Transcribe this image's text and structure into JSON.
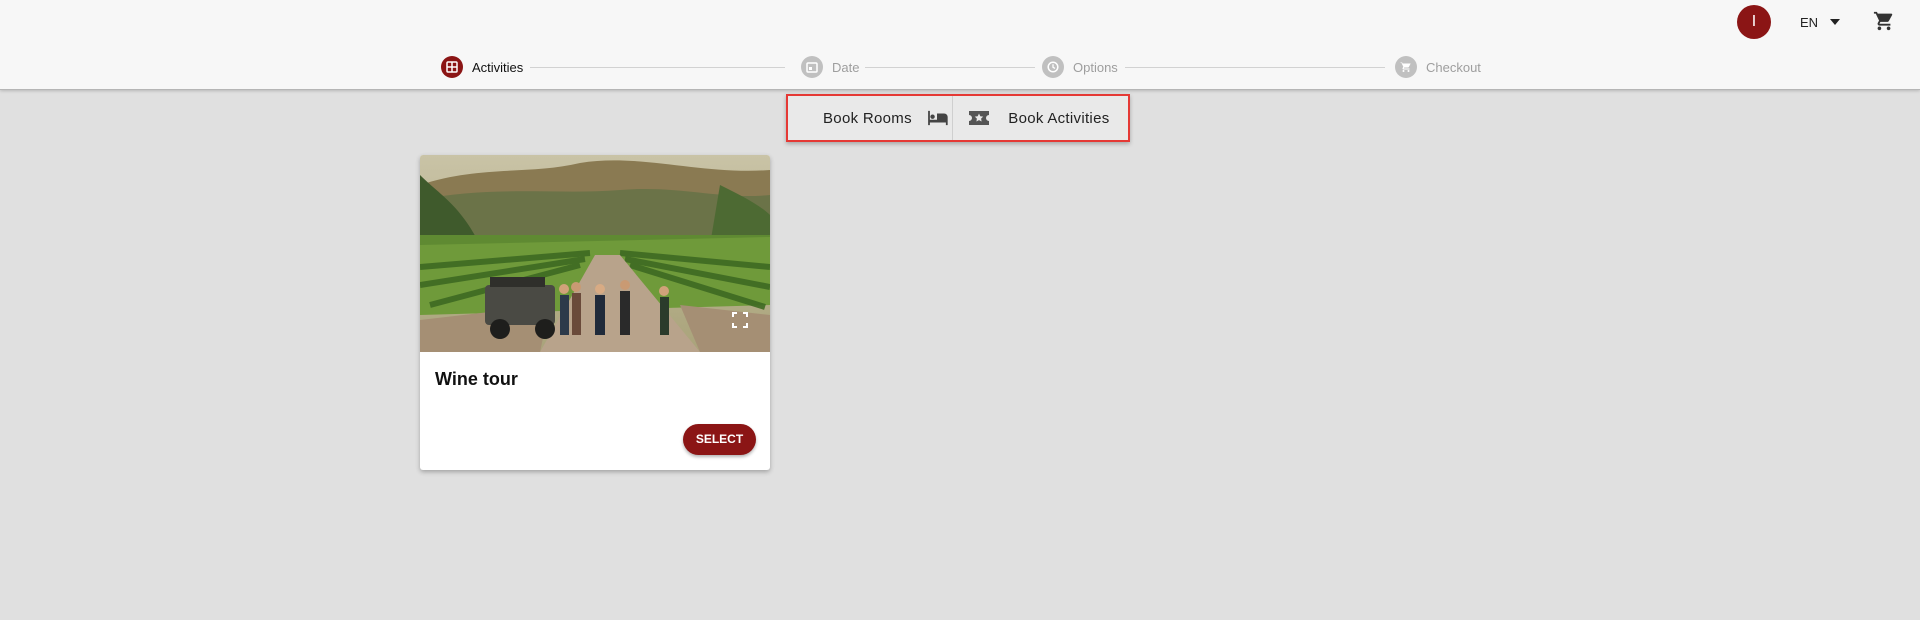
{
  "header": {
    "avatar_initial": "I",
    "language": "EN"
  },
  "stepper": {
    "steps": [
      {
        "label": "Activities",
        "state": "active"
      },
      {
        "label": "Date",
        "state": "inactive"
      },
      {
        "label": "Options",
        "state": "inactive"
      },
      {
        "label": "Checkout",
        "state": "inactive"
      }
    ]
  },
  "booking_toggle": {
    "rooms_label": "Book Rooms",
    "activities_label": "Book Activities"
  },
  "activities": [
    {
      "title": "Wine tour",
      "select_label": "SELECT"
    }
  ],
  "colors": {
    "accent": "#8b1515",
    "highlight_border": "#e53935",
    "page_background": "#e0e0e0",
    "header_background": "#f7f7f7"
  },
  "icons": {
    "avatar": "user-avatar",
    "language_dropdown": "caret-down-icon",
    "cart": "shopping-cart-icon",
    "step_activities": "activities-grid-icon",
    "step_date": "calendar-icon",
    "step_options": "clock-icon",
    "step_checkout": "cart-icon",
    "book_rooms": "bed-icon",
    "book_activities": "ticket-star-icon",
    "image_expand": "fullscreen-icon"
  }
}
